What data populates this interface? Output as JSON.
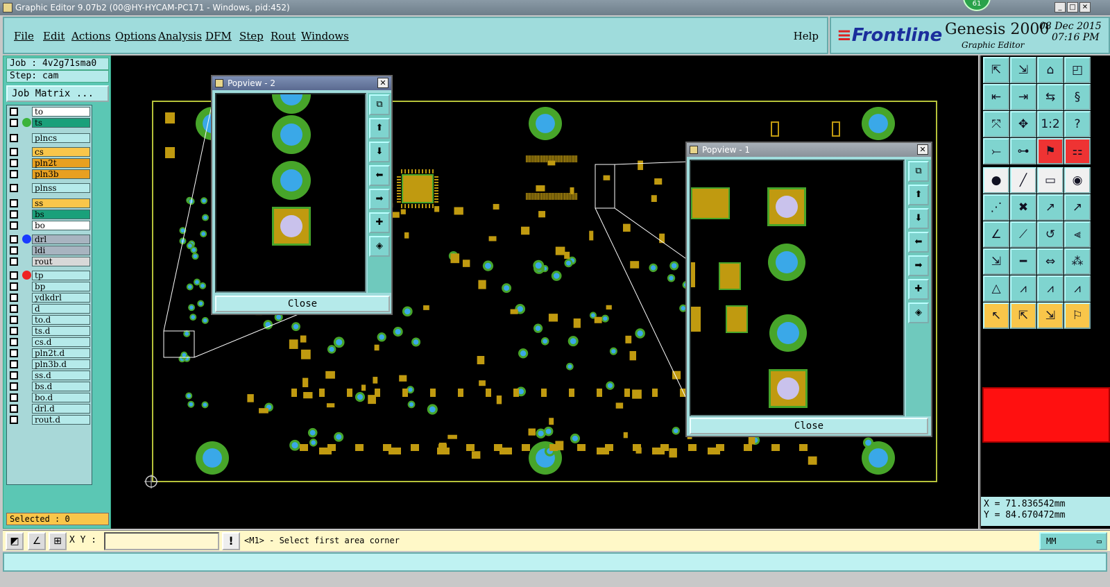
{
  "window": {
    "title": "Graphic Editor 9.07b2 (00@HY-HYCAM-PC171 - Windows, pid:452)",
    "badge": "61"
  },
  "menu": {
    "items": [
      "File",
      "Edit",
      "Actions",
      "Options",
      "Analysis",
      "DFM",
      "Step",
      "Rout",
      "Windows"
    ],
    "help": "Help"
  },
  "brand": {
    "logo": "Frontline",
    "product": "Genesis 2000",
    "subtitle": "Graphic Editor",
    "date": "08 Dec 2015",
    "time": "07:16 PM"
  },
  "left": {
    "job": "Job : 4v2g71sma0",
    "step": "Step: cam",
    "job_matrix": "Job Matrix ...",
    "selected": "Selected : 0",
    "layers": [
      {
        "name": "to",
        "bg": "#ffffff",
        "dot": ""
      },
      {
        "name": "ts",
        "bg": "#1aa07a",
        "dot": "#3bb33b"
      },
      {
        "name": "plncs",
        "bg": "#b5eaea",
        "dot": ""
      },
      {
        "name": "cs",
        "bg": "#f9c64a",
        "dot": ""
      },
      {
        "name": "pln2t",
        "bg": "#e8a020",
        "dot": ""
      },
      {
        "name": "pln3b",
        "bg": "#e8a020",
        "dot": ""
      },
      {
        "name": "plnss",
        "bg": "#b5eaea",
        "dot": ""
      },
      {
        "name": "ss",
        "bg": "#f9c64a",
        "dot": ""
      },
      {
        "name": "bs",
        "bg": "#1aa07a",
        "dot": ""
      },
      {
        "name": "bo",
        "bg": "#ffffff",
        "dot": ""
      },
      {
        "name": "drl",
        "bg": "#a8b4c0",
        "dot": "#1a3bff"
      },
      {
        "name": "ldi",
        "bg": "#a8b4c0",
        "dot": ""
      },
      {
        "name": "rout",
        "bg": "#d8d8d8",
        "dot": ""
      },
      {
        "name": "tp",
        "bg": "#b5eaea",
        "dot": "#ee2222"
      },
      {
        "name": "bp",
        "bg": "#b5eaea",
        "dot": ""
      },
      {
        "name": "ydkdrl",
        "bg": "#b5eaea",
        "dot": ""
      },
      {
        "name": "d",
        "bg": "#b5eaea",
        "dot": ""
      },
      {
        "name": "to.d",
        "bg": "#b5eaea",
        "dot": ""
      },
      {
        "name": "ts.d",
        "bg": "#b5eaea",
        "dot": ""
      },
      {
        "name": "cs.d",
        "bg": "#b5eaea",
        "dot": ""
      },
      {
        "name": "pln2t.d",
        "bg": "#b5eaea",
        "dot": ""
      },
      {
        "name": "pln3b.d",
        "bg": "#b5eaea",
        "dot": ""
      },
      {
        "name": "ss.d",
        "bg": "#b5eaea",
        "dot": ""
      },
      {
        "name": "bs.d",
        "bg": "#b5eaea",
        "dot": ""
      },
      {
        "name": "bo.d",
        "bg": "#b5eaea",
        "dot": ""
      },
      {
        "name": "drl.d",
        "bg": "#b5eaea",
        "dot": ""
      },
      {
        "name": "rout.d",
        "bg": "#b5eaea",
        "dot": ""
      }
    ]
  },
  "popview2": {
    "title": "Popview - 2",
    "close": "Close"
  },
  "popview1": {
    "title": "Popview - 1",
    "close": "Close"
  },
  "coords": {
    "x": "X = 71.836542mm",
    "y": "Y = 84.670472mm"
  },
  "cmd": {
    "xy_label": "X Y :",
    "xy_value": "",
    "prompt": "<M1> - Select first area corner",
    "units": "MM"
  },
  "colors": {
    "pad": "#c09a10",
    "ring": "#47a52a",
    "hole": "#3aa8e8",
    "square_hole": "#c9c2ec",
    "outline": "#b6c23a"
  }
}
